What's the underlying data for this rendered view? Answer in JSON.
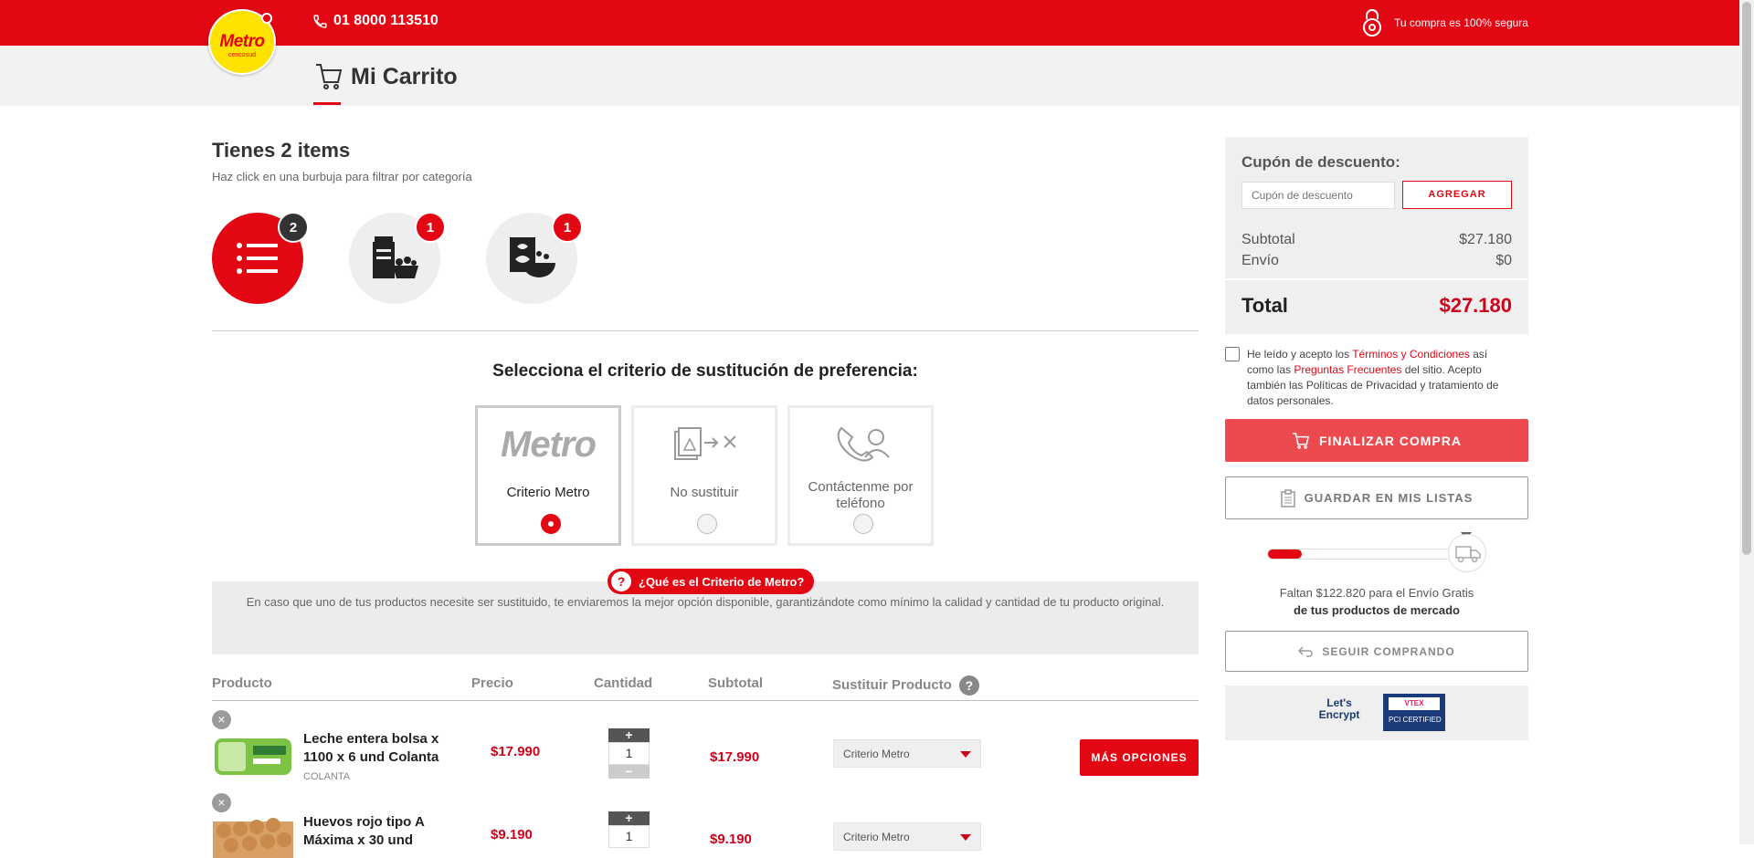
{
  "header": {
    "logo_text": "Metro",
    "logo_sub": "cencosud",
    "phone": "01 8000 113510",
    "secure_text": "Tu compra es 100% segura",
    "accent_color": "#e30613"
  },
  "page": {
    "title": "Mi Carrito"
  },
  "items": {
    "title": "Tienes 2 items",
    "hint": "Haz click en una burbuja para filtrar por categoría",
    "bubbles": [
      {
        "icon": "list-icon",
        "count": "2",
        "active": true
      },
      {
        "icon": "pantry-icon",
        "count": "1",
        "active": false
      },
      {
        "icon": "breakfast-icon",
        "count": "1",
        "active": false
      }
    ]
  },
  "criteria": {
    "title": "Selecciona el criterio de sustitución de preferencia:",
    "options": [
      {
        "logo": "Metro",
        "label": "Criterio Metro",
        "selected": true
      },
      {
        "icon": "no-substitute-icon",
        "label": "No sustituir",
        "selected": false
      },
      {
        "icon": "phone-contact-icon",
        "label": "Contáctenme por teléfono",
        "selected": false
      }
    ],
    "help_pill": "¿Qué es el Criterio de Metro?",
    "help_q": "?",
    "info": "En caso que uno de tus productos necesite ser sustituido, te enviaremos la mejor opción disponible, garantizándote como mínimo la calidad y cantidad de tu producto original."
  },
  "table": {
    "headers": [
      "Producto",
      "Precio",
      "Cantidad",
      "Subtotal",
      "Sustituir Producto"
    ],
    "help_q": "?",
    "rows": [
      {
        "name": "Leche entera bolsa x 1100 x 6 und Colanta",
        "brand": "COLANTA",
        "price": "$17.990",
        "qty": "1",
        "subtotal": "$17.990",
        "sustituir": "Criterio Metro",
        "more": "MÁS OPCIONES"
      },
      {
        "name": "Huevos rojo tipo A Máxima x 30 und",
        "brand": "",
        "price": "$9.190",
        "qty": "1",
        "subtotal": "$9.190",
        "sustituir": "Criterio Metro",
        "more": ""
      }
    ],
    "plus": "+",
    "minus": "−",
    "remove": "×"
  },
  "summary": {
    "coupon_label": "Cupón de descuento:",
    "coupon_placeholder": "Cupón de descuento",
    "coupon_button": "AGREGAR",
    "subtotal_label": "Subtotal",
    "subtotal_value": "$27.180",
    "envio_label": "Envío",
    "envio_value": "$0",
    "total_label": "Total",
    "total_value": "$27.180"
  },
  "terms": {
    "t1": "He leído y acepto los ",
    "link1": "Términos y Condiciones",
    "t2": " así como las ",
    "link2": "Preguntas Frecuentes",
    "t3": " del sitio. Acepto también las Políticas de Privacidad y tratamiento de datos personales."
  },
  "actions": {
    "finalizar": "FINALIZAR COMPRA",
    "guardar": "GUARDAR EN MIS LISTAS",
    "seguir": "SEGUIR COMPRANDO"
  },
  "shipping": {
    "progress_fraction": 0.18,
    "line1": "Faltan $122.820 para el Envío Gratis",
    "line2": "de tus productos de mercado"
  },
  "certs": {
    "le_line1": "Let's",
    "le_line2": "Encrypt",
    "vtex": "VTEX",
    "pci": "PCI CERTIFIED"
  }
}
